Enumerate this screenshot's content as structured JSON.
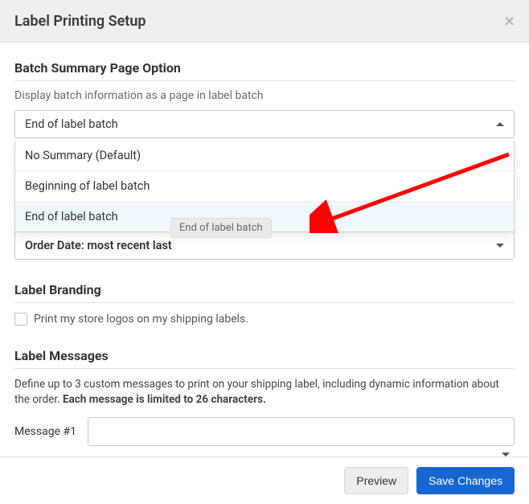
{
  "header": {
    "title": "Label Printing Setup"
  },
  "batch_summary": {
    "title": "Batch Summary Page Option",
    "description": "Display batch information as a page in label batch",
    "selected": "End of label batch",
    "options": [
      "No Summary (Default)",
      "Beginning of label batch",
      "End of label batch"
    ],
    "tooltip": "End of label batch"
  },
  "sort_select": {
    "value": "Order Date: most recent last"
  },
  "label_branding": {
    "title": "Label Branding",
    "checkbox_label": "Print my store logos on my shipping labels."
  },
  "label_messages": {
    "title": "Label Messages",
    "description_prefix": "Define up to 3 custom messages to print on your shipping label, including dynamic information about the order. ",
    "description_bold": "Each message is limited to 26 characters.",
    "message1_label": "Message #1",
    "message1_value": ""
  },
  "footer": {
    "preview": "Preview",
    "save": "Save Changes"
  }
}
